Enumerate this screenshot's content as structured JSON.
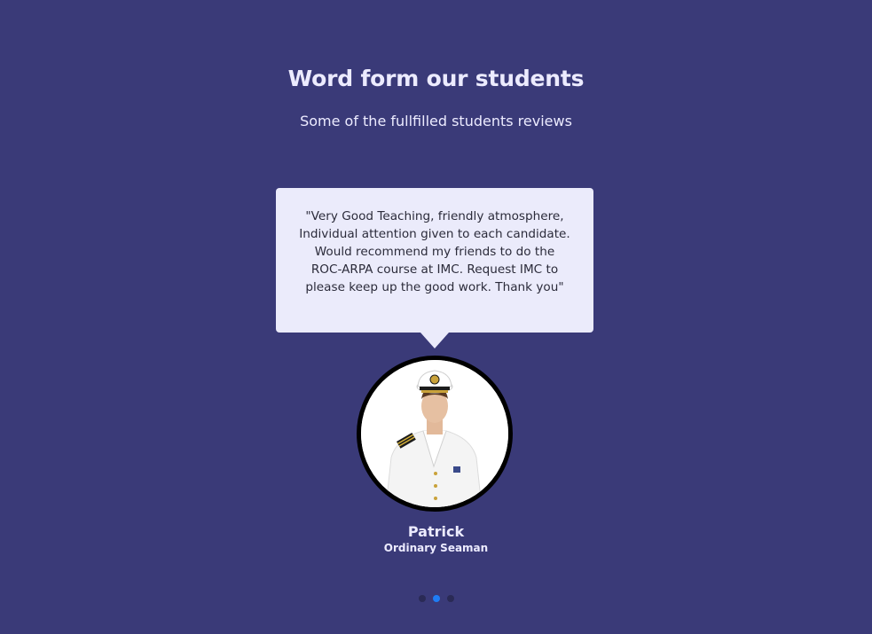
{
  "section": {
    "title": "Word form our students",
    "subtitle": "Some of the fullfilled students reviews"
  },
  "testimonial": {
    "quote": "\"Very Good Teaching, friendly atmosphere, Individual attention given to each candidate. Would recommend my friends to do the ROC-ARPA course at IMC. Request IMC to please keep up the good work. Thank you\"",
    "name": "Patrick",
    "role": "Ordinary Seaman"
  },
  "carousel": {
    "total_slides": 3,
    "active_index": 1
  },
  "colors": {
    "background": "#3a3a78",
    "bubble": "#ebebfb",
    "text_light": "#ecebff",
    "dot_active": "#1f7df5",
    "dot_inactive": "#2a2a55"
  }
}
